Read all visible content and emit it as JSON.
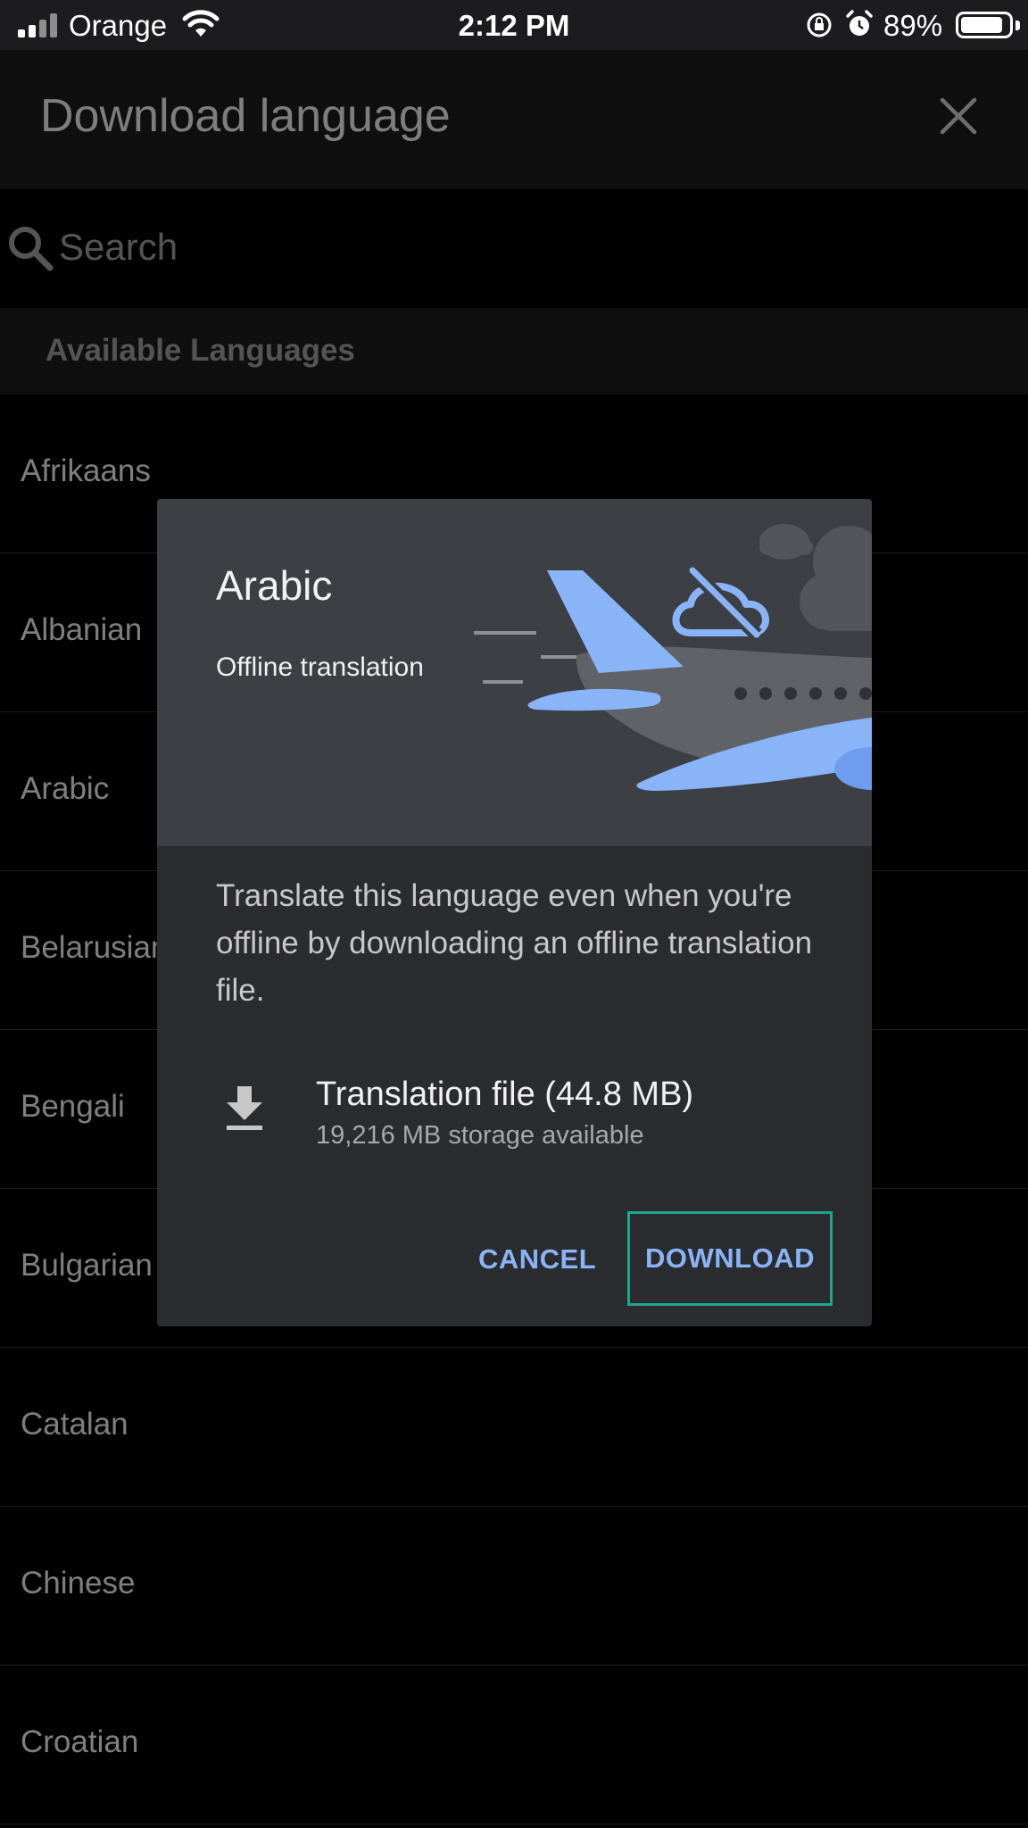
{
  "status_bar": {
    "carrier": "Orange",
    "time": "2:12 PM",
    "battery_percent": "89%",
    "battery_level": 0.89,
    "icons": [
      "signal-icon",
      "wifi-icon",
      "orientation-lock-icon",
      "alarm-icon",
      "battery-icon"
    ]
  },
  "header": {
    "title": "Download language",
    "close_icon": "close-icon"
  },
  "search": {
    "placeholder": "Search",
    "value": "",
    "icon": "search-icon"
  },
  "section": {
    "title": "Available Languages"
  },
  "languages": [
    "Afrikaans",
    "Albanian",
    "Arabic",
    "Belarusian",
    "Bengali",
    "Bulgarian",
    "Catalan",
    "Chinese",
    "Croatian"
  ],
  "dialog": {
    "language": "Arabic",
    "subtitle": "Offline translation",
    "body": "Translate this language even when you're offline by downloading an offline translation file.",
    "file_title": "Translation file (44.8 MB)",
    "storage": "19,216 MB storage available",
    "cancel_label": "CANCEL",
    "download_label": "DOWNLOAD",
    "illustration": "airplane-offline-cloud-illustration"
  },
  "colors": {
    "accent": "#8ab4f8",
    "focus_outline": "#1fa68e",
    "dialog_bg": "#2b2c2f",
    "hero_bg": "#3c3f43",
    "header_bg": "#1c1c1e"
  }
}
